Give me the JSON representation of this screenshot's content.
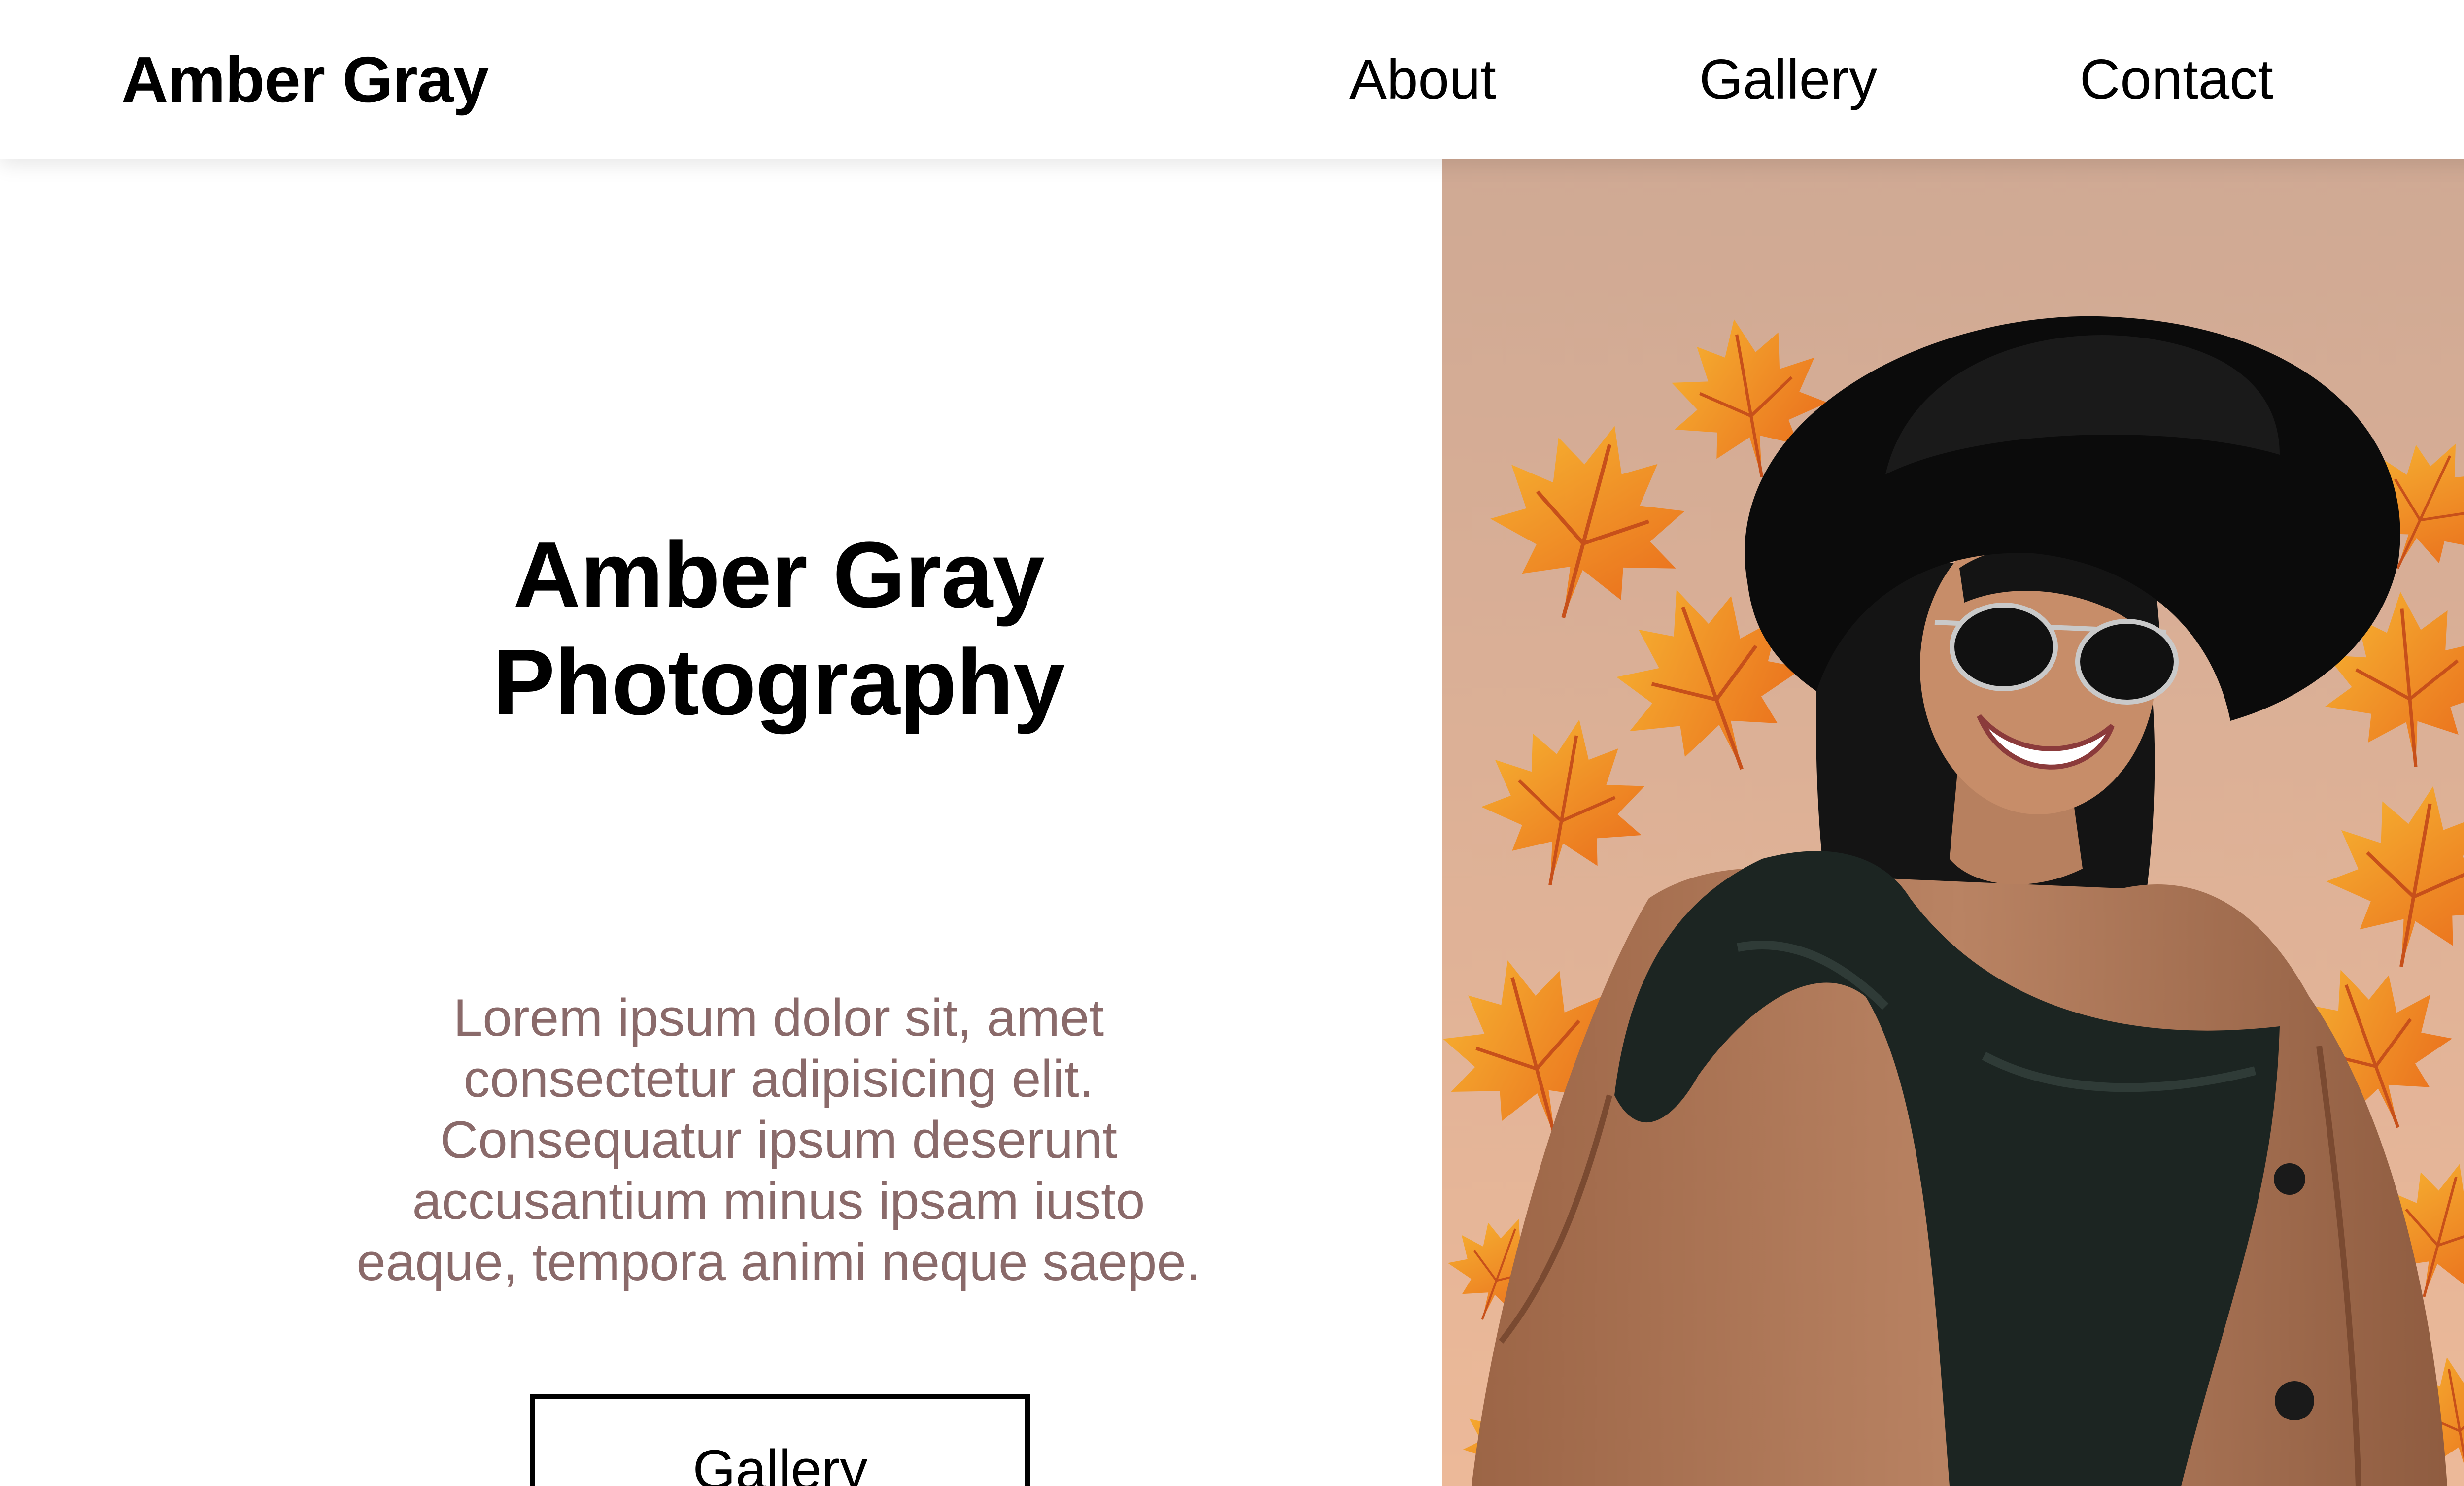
{
  "header": {
    "brand": "Amber Gray",
    "nav": [
      {
        "label": "About"
      },
      {
        "label": "Gallery"
      },
      {
        "label": "Contact"
      }
    ]
  },
  "hero": {
    "title_lines": [
      "Amber Gray",
      "Photography"
    ],
    "body_lines": [
      "Lorem ipsum dolor sit, amet",
      "consectetur adipisicing elit.",
      "Consequatur ipsum deserunt",
      "accusantium minus ipsam iusto",
      "eaque, tempora animi neque saepe."
    ],
    "button_label": "Gallery"
  },
  "colors": {
    "photo_background_top": "#cfa994",
    "photo_background_bottom": "#e9b89a",
    "leaf_orange": "#f08a1c",
    "leaf_yellow": "#f7b733",
    "coat": "#b07a58",
    "scarf": "#1b2320",
    "body_text": "#8a6a6a"
  },
  "icons": {
    "photo": "portrait-photo-woman-in-hat-with-autumn-leaves"
  }
}
